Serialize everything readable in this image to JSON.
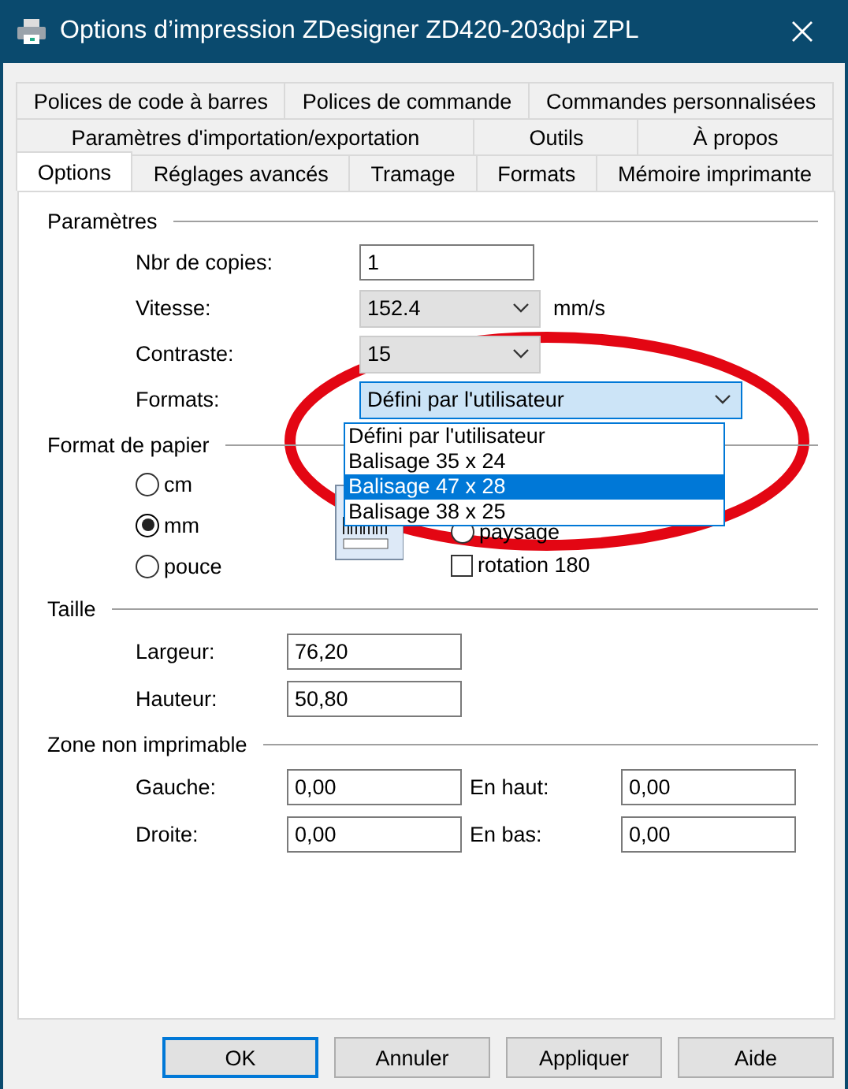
{
  "window": {
    "title": "Options d’impression ZDesigner ZD420-203dpi ZPL"
  },
  "tab_rows": [
    [
      {
        "label": "Polices de code à barres",
        "selected": false
      },
      {
        "label": "Polices de commande",
        "selected": false
      },
      {
        "label": "Commandes personnalisées",
        "selected": false
      }
    ],
    [
      {
        "label": "Paramètres d'importation/exportation",
        "selected": false
      },
      {
        "label": "Outils",
        "selected": false
      },
      {
        "label": "À propos",
        "selected": false
      }
    ],
    [
      {
        "label": "Options",
        "selected": true
      },
      {
        "label": "Réglages avancés",
        "selected": false
      },
      {
        "label": "Tramage",
        "selected": false
      },
      {
        "label": "Formats",
        "selected": false
      },
      {
        "label": "Mémoire imprimante",
        "selected": false
      }
    ]
  ],
  "parameters": {
    "title": "Paramètres",
    "fields": [
      {
        "kind": "text",
        "label": "Nbr de copies:",
        "value": "1"
      },
      {
        "kind": "combo",
        "label": "Vitesse:",
        "value": "152.4",
        "unit": "mm/s"
      },
      {
        "kind": "combo",
        "label": "Contraste:",
        "value": "15"
      },
      {
        "kind": "open-combo",
        "label": "Formats:",
        "value": "Défini par l'utilisateur"
      }
    ]
  },
  "formats_list": [
    {
      "label": "Défini par l'utilisateur",
      "selected": false
    },
    {
      "label": "Balisage 35 x 24",
      "selected": false
    },
    {
      "label": "Balisage 47 x 28",
      "selected": true
    },
    {
      "label": "Balisage 38 x 25",
      "selected": false
    }
  ],
  "paper_format": {
    "title": "Format de papier",
    "units": [
      {
        "label": "cm",
        "selected": false
      },
      {
        "label": "mm",
        "selected": true
      },
      {
        "label": "pouce",
        "selected": false
      }
    ],
    "orientation": [
      {
        "kind": "radio",
        "label": "paysage",
        "selected": false
      },
      {
        "kind": "checkbox",
        "label": "rotation 180",
        "checked": false
      }
    ]
  },
  "size": {
    "title": "Taille",
    "fields": [
      {
        "label": "Largeur:",
        "value": "76,20"
      },
      {
        "label": "Hauteur:",
        "value": "50,80"
      }
    ]
  },
  "non_printable": {
    "title": "Zone non imprimable",
    "rows": [
      [
        {
          "label": "Gauche:",
          "value": "0,00"
        },
        {
          "label": "En haut:",
          "value": "0,00"
        }
      ],
      [
        {
          "label": "Droite:",
          "value": "0,00"
        },
        {
          "label": "En bas:",
          "value": "0,00"
        }
      ]
    ]
  },
  "buttons": [
    {
      "label": "OK",
      "default": true
    },
    {
      "label": "Annuler",
      "default": false
    },
    {
      "label": "Appliquer",
      "default": false
    },
    {
      "label": "Aide",
      "default": false
    }
  ]
}
